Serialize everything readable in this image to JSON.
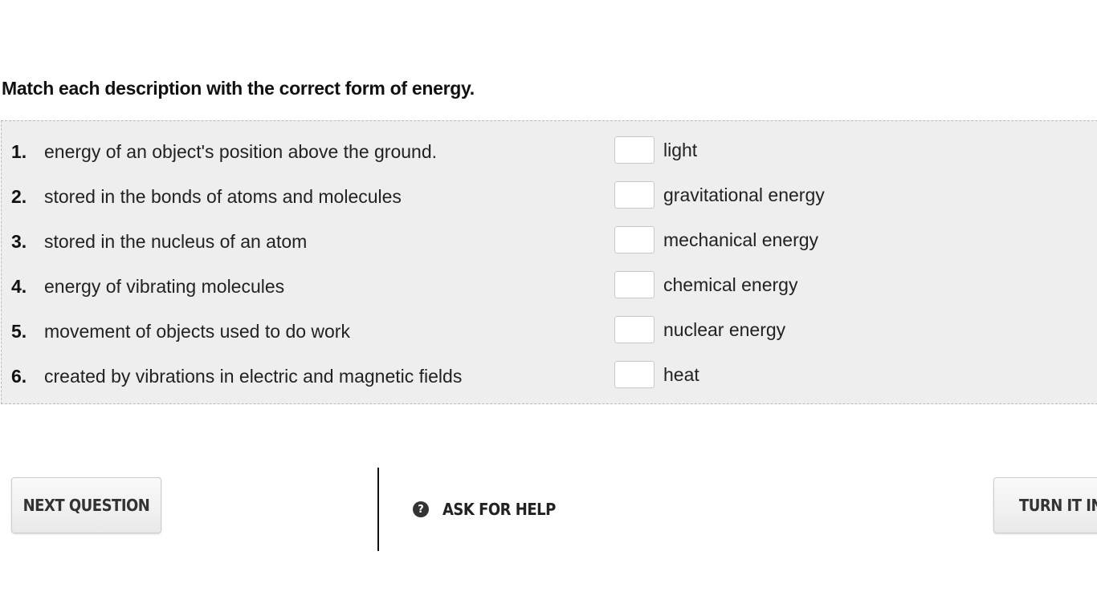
{
  "question": {
    "prompt": "Match each description with the correct form of energy."
  },
  "items": [
    {
      "number": "1.",
      "description": "energy of an object's position above the ground.",
      "answer": "",
      "choice": "light"
    },
    {
      "number": "2.",
      "description": "stored in the bonds of atoms and molecules",
      "answer": "",
      "choice": "gravitational energy"
    },
    {
      "number": "3.",
      "description": "stored in the nucleus of an atom",
      "answer": "",
      "choice": "mechanical energy"
    },
    {
      "number": "4.",
      "description": "energy of vibrating molecules",
      "answer": "",
      "choice": "chemical energy"
    },
    {
      "number": "5.",
      "description": "movement of objects used to do work",
      "answer": "",
      "choice": "nuclear energy"
    },
    {
      "number": "6.",
      "description": "created by vibrations in electric and magnetic fields",
      "answer": "",
      "choice": "heat"
    }
  ],
  "footer": {
    "next_label": "NEXT QUESTION",
    "help_label": "ASK FOR HELP",
    "help_icon": "question-circle-icon",
    "help_icon_glyph": "?",
    "turn_in_label": "TURN IT IN"
  }
}
